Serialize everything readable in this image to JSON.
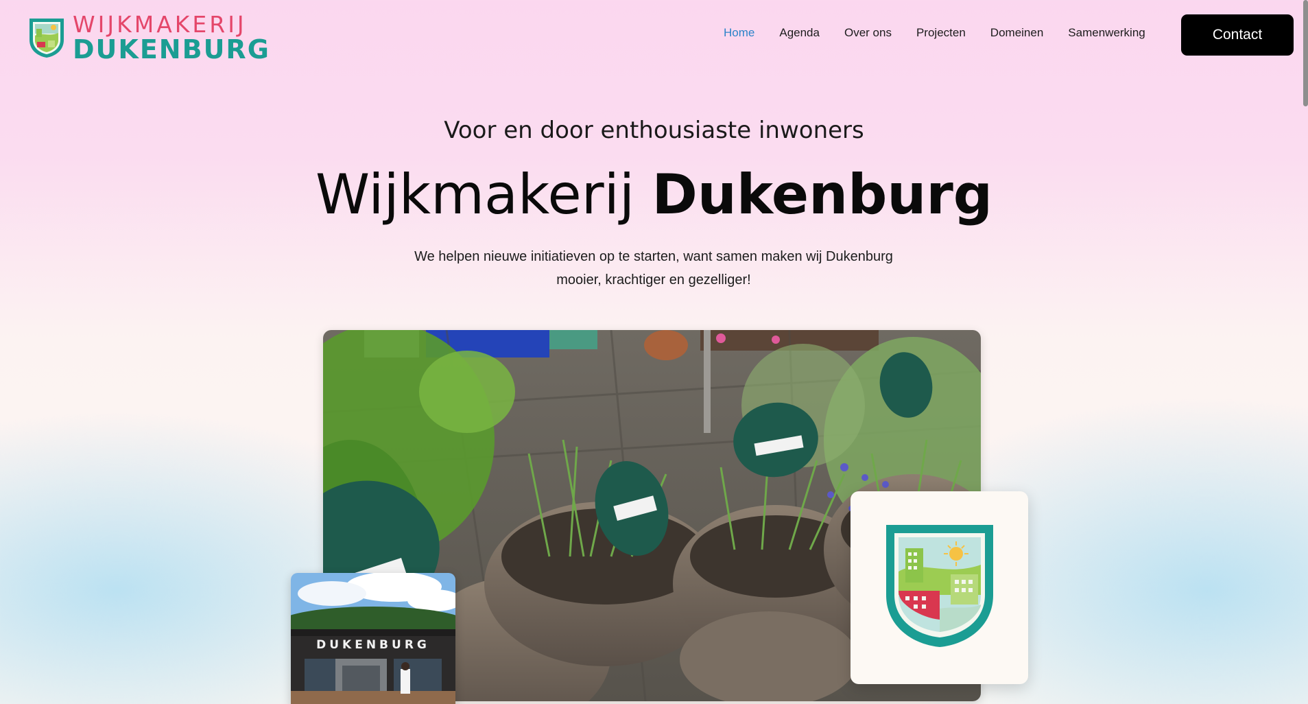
{
  "header": {
    "logo_line1": "WIJKMAKERIJ",
    "logo_line2": "DUKENBURG",
    "nav": [
      {
        "label": "Home",
        "active": true
      },
      {
        "label": "Agenda"
      },
      {
        "label": "Over ons"
      },
      {
        "label": "Projecten"
      },
      {
        "label": "Domeinen"
      },
      {
        "label": "Samenwerking"
      }
    ],
    "contact_label": "Contact"
  },
  "hero": {
    "subtitle": "Voor en door enthousiaste inwoners",
    "title_part1": "Wijkmakerij",
    "title_part2": "Dukenburg",
    "description_line1": "We helpen nieuwe initiatieven op te starten, want samen maken wij Dukenburg",
    "description_line2": "mooier, krachtiger en gezelliger!"
  },
  "images": {
    "main_photo": "herb-planters-photo",
    "small_photo": "dukenburg-building-photo",
    "small_photo_sign": "DUKENBURG",
    "emblem": "wijkmakerij-emblem"
  },
  "colors": {
    "brand_pink": "#e4466a",
    "brand_teal": "#1b9d93",
    "nav_active": "#2b83c9",
    "button_bg": "#000000"
  }
}
